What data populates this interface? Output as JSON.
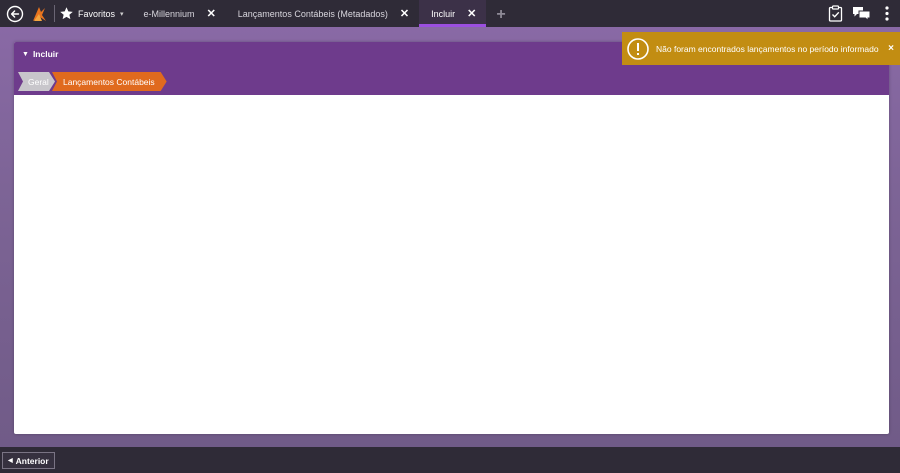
{
  "topbar": {
    "favorites_label": "Favoritos",
    "favorites_caret": "▾",
    "tabs": [
      {
        "label": "e-Millennium",
        "close": "✕"
      },
      {
        "label": "Lançamentos Contábeis (Metadados)",
        "close": "✕"
      },
      {
        "label": "Incluir",
        "close": "✕"
      }
    ],
    "add_tab": "+"
  },
  "panel": {
    "title": "Incluir",
    "breadcrumbs": [
      "Geral",
      "Lançamentos Contábeis"
    ]
  },
  "toast": {
    "message": "Não foram encontrados lançamentos no período informado",
    "close": "×"
  },
  "bottombar": {
    "prev_label": "Anterior"
  },
  "colors": {
    "topbar_bg": "#2f2b37",
    "panel_header": "#6e3b8c",
    "active_tab_underline": "#9b4fe0",
    "crumb_active": "#e06a1e",
    "toast_bg": "#c28d12"
  }
}
